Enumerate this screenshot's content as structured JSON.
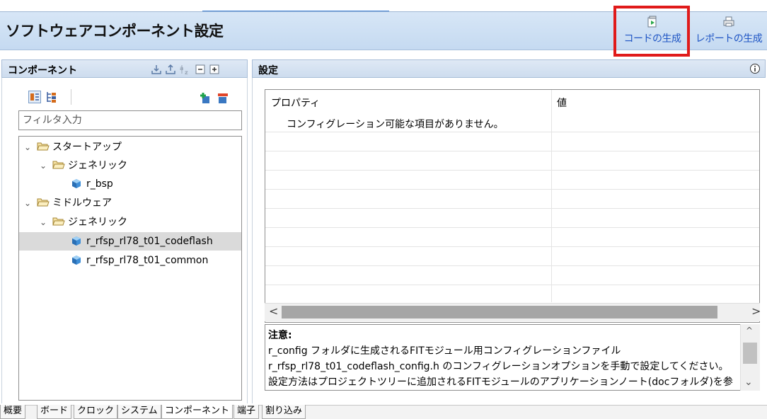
{
  "header": {
    "title": "ソフトウェアコンポーネント設定",
    "generate_code_label": "コードの生成",
    "generate_report_label": "レポートの生成"
  },
  "left_panel": {
    "title": "コンポーネント",
    "filter_placeholder": "フィルタ入力",
    "tree": [
      {
        "label": "スタートアップ",
        "type": "folder",
        "expanded": true,
        "level": 0
      },
      {
        "label": "ジェネリック",
        "type": "folder",
        "expanded": true,
        "level": 1
      },
      {
        "label": "r_bsp",
        "type": "component",
        "level": 2
      },
      {
        "label": "ミドルウェア",
        "type": "folder",
        "expanded": true,
        "level": 0
      },
      {
        "label": "ジェネリック",
        "type": "folder",
        "expanded": true,
        "level": 1
      },
      {
        "label": "r_rfsp_rl78_t01_codeflash",
        "type": "component",
        "level": 2,
        "selected": true
      },
      {
        "label": "r_rfsp_rl78_t01_common",
        "type": "component",
        "level": 2
      }
    ]
  },
  "right_panel": {
    "title": "設定",
    "table": {
      "col_property": "プロパティ",
      "col_value": "値",
      "rows": [
        {
          "property": "コンフィグレーション可能な項目がありません。",
          "value": ""
        }
      ]
    },
    "notes": [
      "注意:",
      "r_config フォルダに生成されるFITモジュール用コンフィグレーションファイル",
      "r_rfsp_rl78_t01_codeflash_config.h のコンフィグレーションオプションを手動で設定してください。",
      "設定方法はプロジェクトツリーに追加されるFITモジュールのアプリケーションノート(docフォルダ)を参"
    ]
  },
  "tabs": [
    "概要",
    "ボード",
    "クロック",
    "システム",
    "コンポーネント",
    "端子",
    "割り込み"
  ],
  "active_tab": "コンポーネント",
  "colors": {
    "header_bg": "#c9dcf1",
    "link_blue": "#1f55c4",
    "highlight_red": "#e01a1a",
    "selection_gray": "#dadada"
  }
}
